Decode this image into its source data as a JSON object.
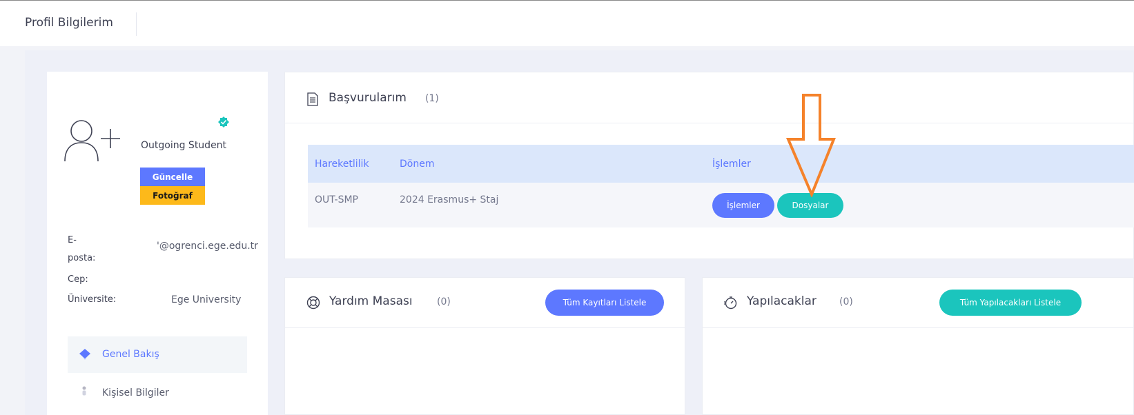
{
  "header": {
    "title": "Profil Bilgilerim"
  },
  "profile": {
    "role": "Outgoing Student",
    "update_button": "Güncelle",
    "photo_button": "Fotoğraf",
    "email_label_line1": "E-",
    "email_label_line2": "posta:",
    "email_value": "'@ogrenci.ege.edu.tr",
    "phone_label": "Cep:",
    "university_label": "Üniversite:",
    "university_value": "Ege University",
    "nav": [
      {
        "label": "Genel Bakış",
        "icon": "layers-icon",
        "active": true
      },
      {
        "label": "Kişisel Bilgiler",
        "icon": "person-icon",
        "active": false
      }
    ]
  },
  "applications": {
    "title": "Başvurularım",
    "count": "(1)",
    "columns": [
      "Hareketlilik",
      "Dönem",
      "İşlemler"
    ],
    "rows": [
      {
        "mobility": "OUT-SMP",
        "term": "2024 Erasmus+ Staj",
        "actions_button": "İşlemler",
        "files_button": "Dosyalar"
      }
    ]
  },
  "helpdesk": {
    "title": "Yardım Masası",
    "count": "(0)",
    "list_button": "Tüm Kayıtları Listele"
  },
  "todos": {
    "title": "Yapılacaklar",
    "count": "(0)",
    "list_button": "Tüm Yapılacakları Listele"
  },
  "colors": {
    "primary": "#5d78ff",
    "teal": "#1bc5bd",
    "warning": "#fdb91a",
    "annotation_arrow": "#f5822a",
    "table_header": "#dbe7fb"
  }
}
